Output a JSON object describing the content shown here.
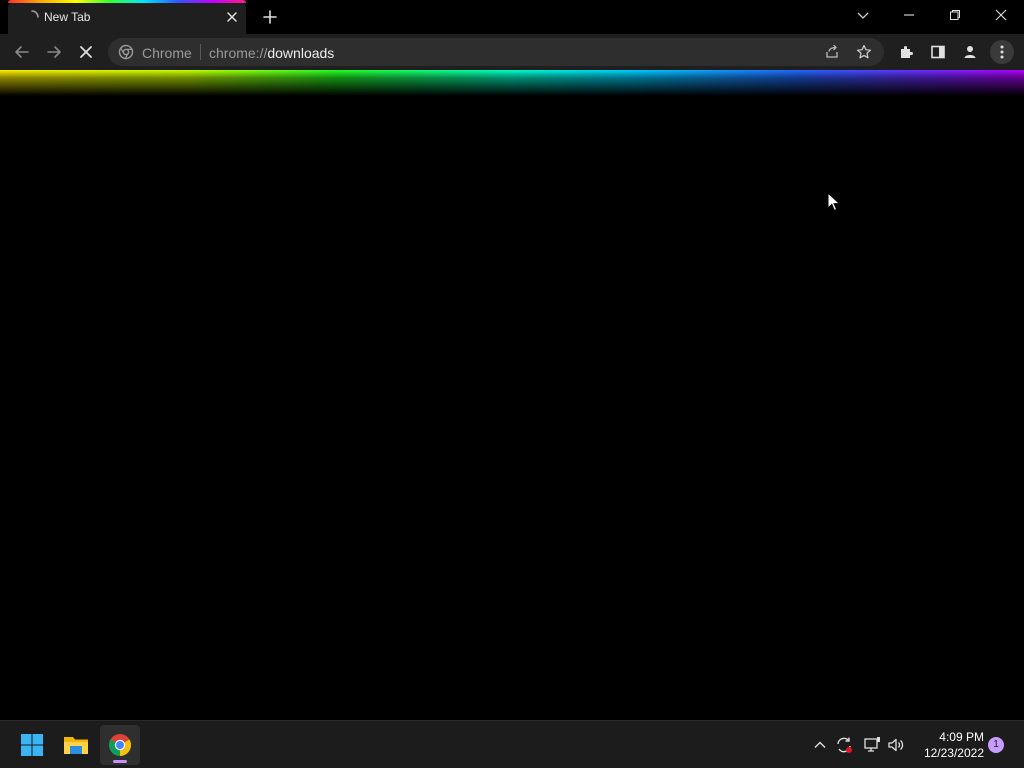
{
  "browser": {
    "tab": {
      "title": "New Tab",
      "favicon": "loading-icon"
    },
    "window_controls": [
      "tab-search-icon",
      "minimize-icon",
      "restore-icon",
      "close-icon"
    ],
    "omnibox": {
      "chip_label": "Chrome",
      "url_scheme": "chrome://",
      "url_host": "downloads"
    },
    "toolbar_icons": [
      "back-icon",
      "forward-icon",
      "stop-icon",
      "share-icon",
      "bookmark-star-icon",
      "extensions-icon",
      "side-panel-icon",
      "profile-icon",
      "menu-icon"
    ]
  },
  "taskbar": {
    "apps": [
      "windows-start-icon",
      "file-explorer-icon",
      "chrome-icon"
    ],
    "tray_icons": [
      "chevron-up-icon",
      "sync-icon",
      "network-icon",
      "volume-icon"
    ],
    "clock": {
      "time": "4:09 PM",
      "date": "12/23/2022"
    },
    "notification_count": "1"
  },
  "colors": {
    "tab_bg": "#1f1f1f",
    "omnibox_bg": "#2e2e2e",
    "taskbar_bg": "#1c1c1c",
    "notif_badge": "#c89bff",
    "active_indicator": "#c88fff"
  }
}
